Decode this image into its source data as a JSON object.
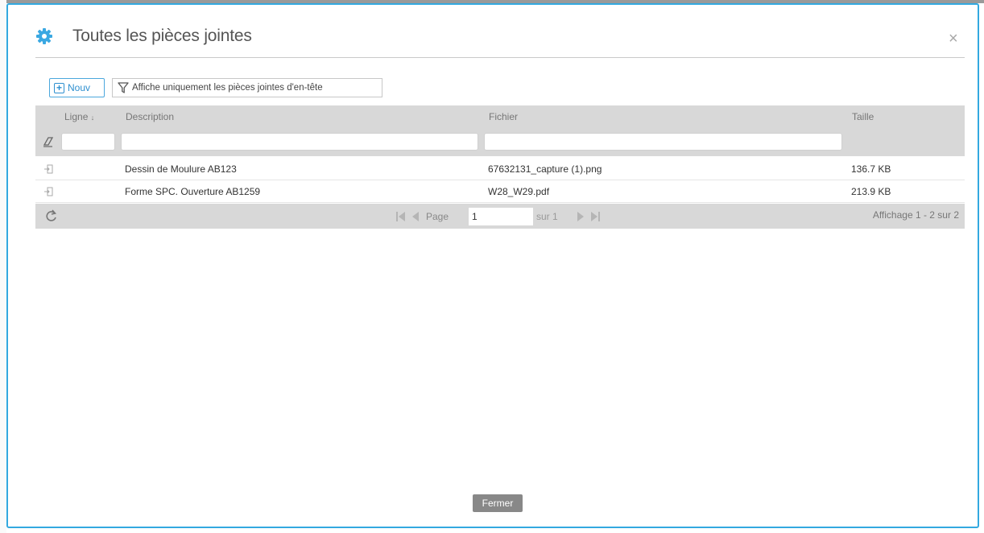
{
  "dialog": {
    "title": "Toutes les pièces jointes",
    "close_symbol": "×",
    "title_icon": "gear-icon",
    "accent_color": "#33a9e0"
  },
  "toolbar": {
    "new_label": "Nouv",
    "filter_label": "Affiche uniquement les pièces jointes d'en-tête"
  },
  "grid": {
    "columns": [
      "Ligne",
      "Description",
      "Fichier",
      "Taille"
    ],
    "sort_indicator": "↓",
    "filters": {
      "ligne": "",
      "description": "",
      "fichier": ""
    },
    "rows": [
      {
        "description": "Dessin de Moulure AB123",
        "file": "67632131_capture (1).png",
        "size": "136.7 KB"
      },
      {
        "description": "Forme SPC. Ouverture AB1259",
        "file": "W28_W29.pdf",
        "size": "213.9 KB"
      }
    ]
  },
  "pager": {
    "page_label": "Page",
    "page_value": "1",
    "of_label": "sur 1",
    "display_info": "Affichage 1 - 2 sur 2"
  },
  "footer": {
    "close_label": "Fermer"
  }
}
